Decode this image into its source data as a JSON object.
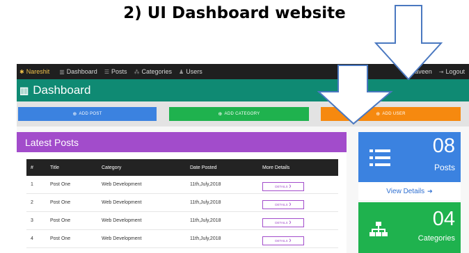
{
  "slide_title": "2)  UI Dashboard website",
  "nav": {
    "brand": "Nareshit",
    "items": [
      "Dashboard",
      "Posts",
      "Categories",
      "Users"
    ],
    "user": "Naveen",
    "logout": "Logout"
  },
  "header": {
    "title": "Dashboard"
  },
  "actions": {
    "add_post": "ADD POST",
    "add_category": "ADD CATEGORY",
    "add_user": "ADD USER"
  },
  "latest_posts": {
    "title": "Latest Posts",
    "columns": [
      "#",
      "Title",
      "Category",
      "Date Posted",
      "More Details"
    ],
    "rows": [
      [
        "1",
        "Post One",
        "Web Development",
        "11th,July,2018",
        "DETAILS"
      ],
      [
        "2",
        "Post One",
        "Web Development",
        "11th,July,2018",
        "DETAILS"
      ],
      [
        "3",
        "Post One",
        "Web Development",
        "11th,July,2018",
        "DETAILS"
      ],
      [
        "4",
        "Post One",
        "Web Development",
        "11th,July,2018",
        "DETAILS"
      ]
    ]
  },
  "stats": {
    "posts": {
      "count": "08",
      "label": "Posts",
      "link": "View Details"
    },
    "categories": {
      "count": "04",
      "label": "Categories"
    }
  },
  "colors": {
    "nav_bg": "#1f1f1f",
    "header_bg": "#0f8a73",
    "blue": "#3b82e0",
    "green": "#1fb24e",
    "orange": "#f6890f",
    "purple": "#a24ccb"
  }
}
